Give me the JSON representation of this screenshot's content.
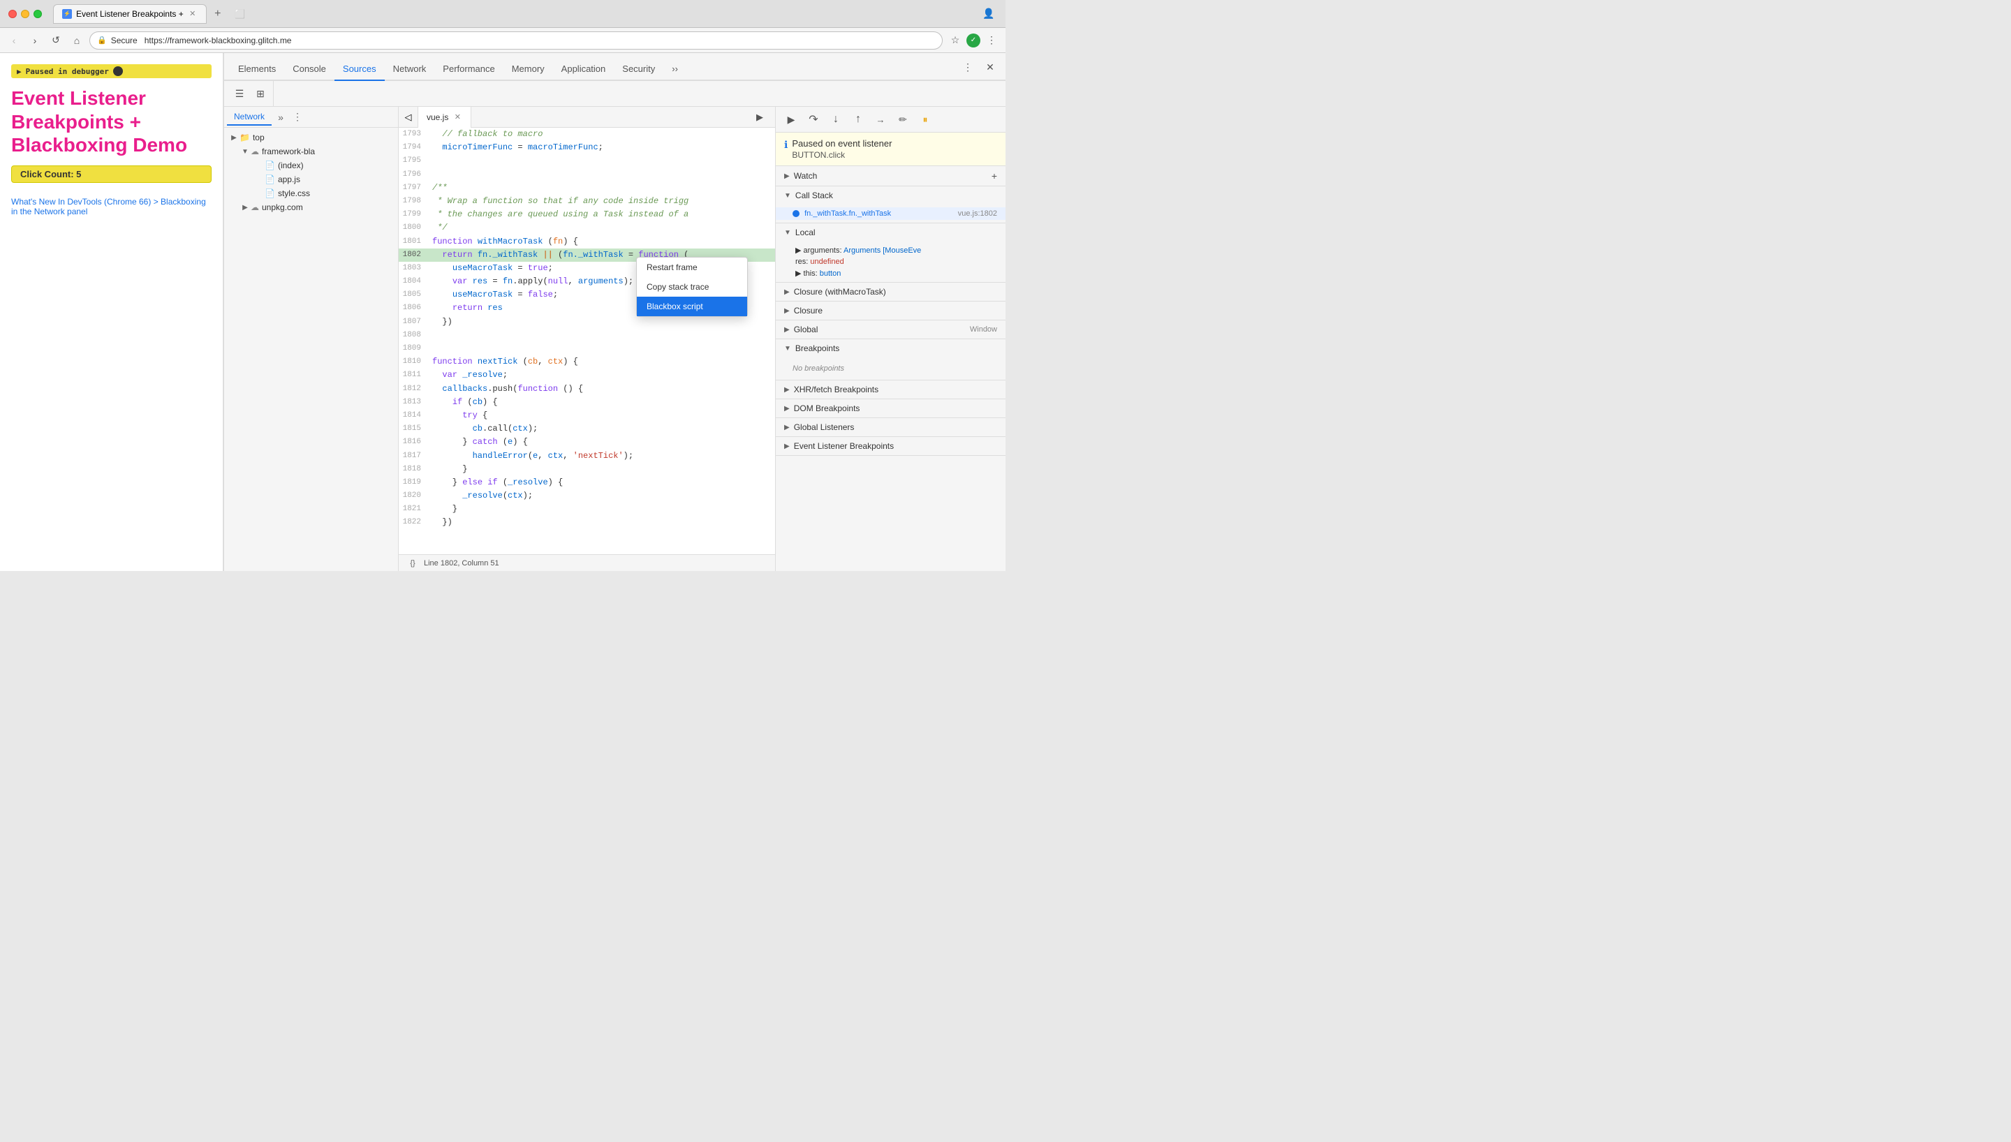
{
  "browser": {
    "tab_title": "Event Listener Breakpoints +",
    "url_secure": "Secure",
    "url": "https://framework-blackboxing.glitch.me"
  },
  "devtools_tabs": [
    {
      "label": "Elements",
      "active": false
    },
    {
      "label": "Console",
      "active": false
    },
    {
      "label": "Sources",
      "active": true
    },
    {
      "label": "Network",
      "active": false
    },
    {
      "label": "Performance",
      "active": false
    },
    {
      "label": "Memory",
      "active": false
    },
    {
      "label": "Application",
      "active": false
    },
    {
      "label": "Security",
      "active": false
    }
  ],
  "page": {
    "paused_label": "Paused in debugger",
    "title": "Event Listener Breakpoints + Blackboxing Demo",
    "click_count_label": "Click Count: 5",
    "links": [
      "What's New In DevTools (Chrome 66) > Blackboxing in the Network panel"
    ]
  },
  "file_panel": {
    "tab": "Network",
    "tree": [
      {
        "level": 0,
        "icon": "folder",
        "name": "top",
        "expanded": true,
        "arrow": "▶"
      },
      {
        "level": 1,
        "icon": "cloud",
        "name": "framework-bla",
        "expanded": true,
        "arrow": "▼"
      },
      {
        "level": 2,
        "icon": "file",
        "name": "(index)",
        "arrow": ""
      },
      {
        "level": 2,
        "icon": "js",
        "name": "app.js",
        "arrow": ""
      },
      {
        "level": 2,
        "icon": "css",
        "name": "style.css",
        "arrow": ""
      },
      {
        "level": 1,
        "icon": "cloud",
        "name": "unpkg.com",
        "expanded": false,
        "arrow": "▶"
      }
    ]
  },
  "editor": {
    "filename": "vue.js",
    "lines": [
      {
        "num": 1793,
        "code": "  // fallback to macro",
        "type": "comment"
      },
      {
        "num": 1794,
        "code": "  microTimerFunc = macroTimerFunc;",
        "type": "code"
      },
      {
        "num": 1795,
        "code": "",
        "type": "code"
      },
      {
        "num": 1796,
        "code": "",
        "type": "code"
      },
      {
        "num": 1797,
        "code": "/**",
        "type": "comment"
      },
      {
        "num": 1798,
        "code": " * Wrap a function so that if any code inside trigg",
        "type": "comment"
      },
      {
        "num": 1799,
        "code": " * the changes are queued using a Task instead of a",
        "type": "comment"
      },
      {
        "num": 1800,
        "code": " */",
        "type": "comment"
      },
      {
        "num": 1801,
        "code": "function withMacroTask (fn) {",
        "type": "code"
      },
      {
        "num": 1802,
        "code": "  return fn._withTask || (fn._withTask = function (",
        "type": "active",
        "highlight": true
      },
      {
        "num": 1803,
        "code": "    useMacroTask = true;",
        "type": "code"
      },
      {
        "num": 1804,
        "code": "    var res = fn.apply(null, arguments);",
        "type": "code"
      },
      {
        "num": 1805,
        "code": "    useMacroTask = false;",
        "type": "code"
      },
      {
        "num": 1806,
        "code": "    return res",
        "type": "code"
      },
      {
        "num": 1807,
        "code": "  })",
        "type": "code"
      },
      {
        "num": 1808,
        "code": "",
        "type": "code"
      },
      {
        "num": 1809,
        "code": "",
        "type": "code"
      },
      {
        "num": 1810,
        "code": "function nextTick (cb, ctx) {",
        "type": "code"
      },
      {
        "num": 1811,
        "code": "  var _resolve;",
        "type": "code"
      },
      {
        "num": 1812,
        "code": "  callbacks.push(function () {",
        "type": "code"
      },
      {
        "num": 1813,
        "code": "    if (cb) {",
        "type": "code"
      },
      {
        "num": 1814,
        "code": "      try {",
        "type": "code"
      },
      {
        "num": 1815,
        "code": "        cb.call(ctx);",
        "type": "code"
      },
      {
        "num": 1816,
        "code": "      } catch (e) {",
        "type": "code"
      },
      {
        "num": 1817,
        "code": "        handleError(e, ctx, 'nextTick');",
        "type": "code"
      },
      {
        "num": 1818,
        "code": "      }",
        "type": "code"
      },
      {
        "num": 1819,
        "code": "    } else if (_resolve) {",
        "type": "code"
      },
      {
        "num": 1820,
        "code": "      _resolve(ctx);",
        "type": "code"
      },
      {
        "num": 1821,
        "code": "    }",
        "type": "code"
      },
      {
        "num": 1822,
        "code": "  })",
        "type": "code"
      }
    ],
    "status_line": "Line 1802, Column 51"
  },
  "right_panel": {
    "paused_title": "Paused on event listener",
    "paused_subtitle": "BUTTON.click",
    "watch_label": "Watch",
    "call_stack_label": "Call Stack",
    "call_stack_items": [
      {
        "fn": "fn._withTask.fn._withTask",
        "file": "vue.js:1802",
        "active": true
      }
    ],
    "scope_sections": [
      {
        "label": "Local",
        "expanded": true
      },
      {
        "label": "Closure (withMacroTask)",
        "expanded": false
      },
      {
        "label": "Closure",
        "expanded": false
      },
      {
        "label": "Global",
        "expanded": false,
        "value": "Window"
      }
    ],
    "local_scope": [
      {
        "name": "▶ arguments:",
        "val": "Arguments [MouseEve"
      },
      {
        "name": "res:",
        "val": "undefined"
      },
      {
        "name": "▶ this:",
        "val": "button"
      }
    ],
    "breakpoints_label": "Breakpoints",
    "no_breakpoints": "No breakpoints",
    "xhr_breakpoints": "XHR/fetch Breakpoints",
    "dom_breakpoints": "DOM Breakpoints",
    "global_listeners": "Global Listeners",
    "event_listener_breakpoints": "Event Listener Breakpoints"
  },
  "context_menu": {
    "items": [
      {
        "label": "Restart frame",
        "selected": false
      },
      {
        "label": "Copy stack trace",
        "selected": false
      },
      {
        "label": "Blackbox script",
        "selected": true
      }
    ]
  },
  "colors": {
    "active_line_bg": "#c8e6c9",
    "selected_menu_bg": "#1a73e8",
    "paused_badge_bg": "#f0e040"
  }
}
